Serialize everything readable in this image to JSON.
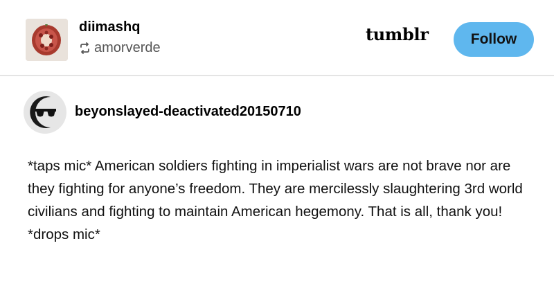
{
  "header": {
    "username": "diimashq",
    "reblogged_from": "amorverde",
    "logo_text": "tumblr",
    "follow_label": "Follow"
  },
  "post": {
    "author": "beyonslayed-deactivated20150710",
    "body": "*taps mic* American soldiers fighting in imperialist wars are not brave nor are they fighting for anyone’s freedom. They are mercilessly slaughtering 3rd world civilians and fighting to maintain American hegemony. That is all, thank you! *drops mic*"
  },
  "icons": {
    "reblog": "reblog-icon",
    "main_avatar": "pomegranate-avatar",
    "post_avatar": "sunglasses-avatar"
  },
  "colors": {
    "follow_button": "#5fb7ee",
    "divider": "#e4e4e4",
    "secondary_text": "#555555"
  }
}
